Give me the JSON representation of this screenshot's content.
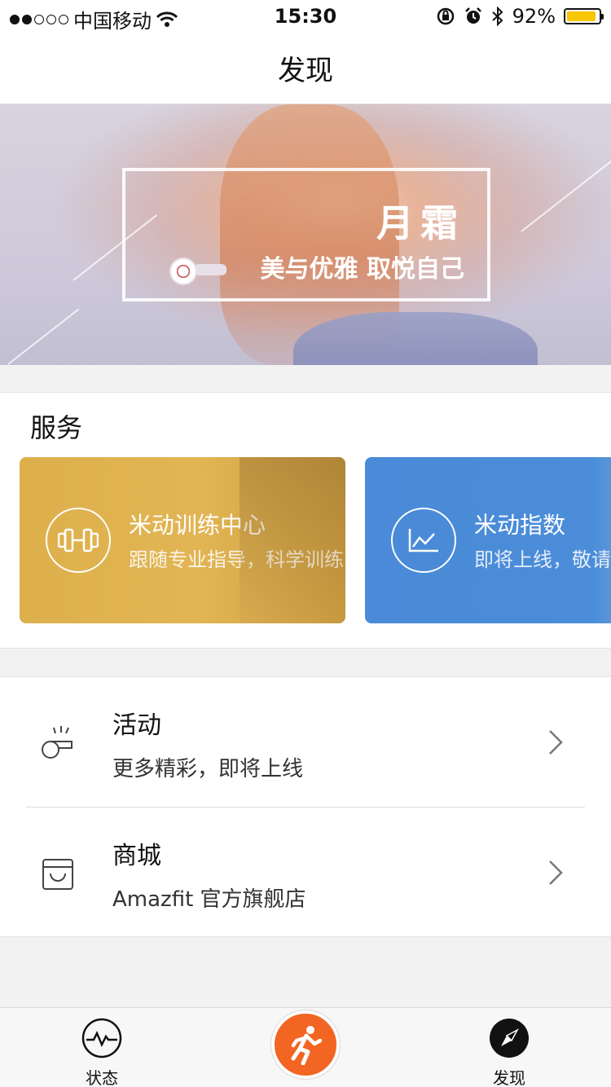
{
  "status_bar": {
    "carrier": "中国移动",
    "time": "15:30",
    "battery": "92%",
    "battery_level": 0.92,
    "signal_dots_filled": 2,
    "signal_dots_total": 5
  },
  "nav": {
    "title": "发现"
  },
  "banner": {
    "title": "月霜",
    "subtitle": "美与优雅 取悦自己"
  },
  "services": {
    "title": "服务",
    "cards": [
      {
        "title": "米动训练中心",
        "subtitle": "跟随专业指导，科学训练",
        "icon": "dumbbell-icon",
        "color": "#deb24e"
      },
      {
        "title": "米动指数",
        "subtitle": "即将上线，敬请期待",
        "icon": "chart-line-icon",
        "color": "#4a8ad8"
      }
    ]
  },
  "list": {
    "items": [
      {
        "title": "活动",
        "subtitle": "更多精彩，即将上线",
        "icon": "whistle-icon"
      },
      {
        "title": "商城",
        "subtitle": "Amazfit 官方旗舰店",
        "icon": "shop-icon"
      }
    ]
  },
  "tabs": {
    "status": {
      "label": "状态",
      "icon": "activity-pulse-icon"
    },
    "run": {
      "icon": "running-man-icon",
      "color": "#f26522"
    },
    "discover": {
      "label": "发现",
      "icon": "compass-icon"
    }
  }
}
